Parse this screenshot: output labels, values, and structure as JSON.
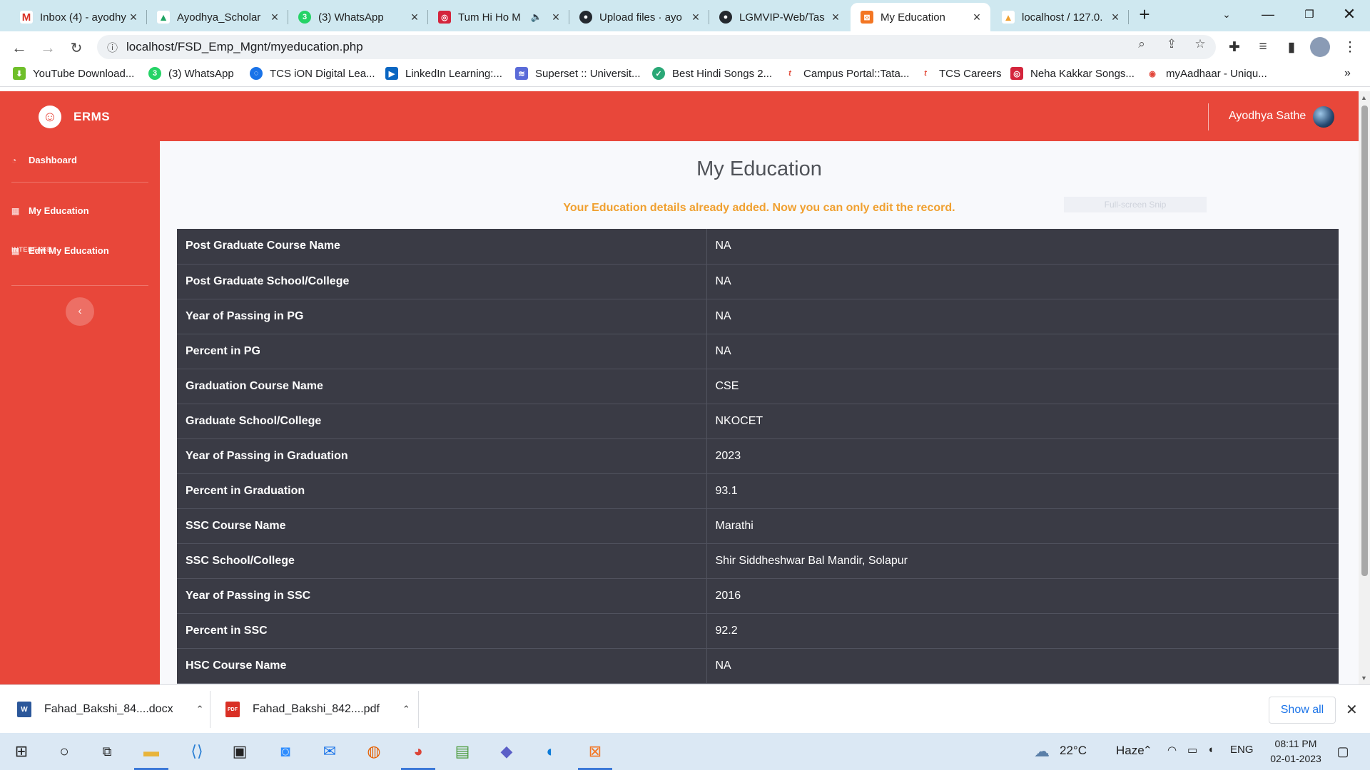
{
  "browser": {
    "tabs": [
      {
        "title": "Inbox (4) - ayodhy",
        "icon": "gmail-icon",
        "color": "#d93025",
        "glyph": "M"
      },
      {
        "title": "Ayodhya_Scholar",
        "icon": "google-drive-icon",
        "color": "#1fa463",
        "glyph": "▲"
      },
      {
        "title": "(3) WhatsApp",
        "icon": "whatsapp-icon",
        "color": "#25d366",
        "glyph": "3"
      },
      {
        "title": "Tum Hi Ho M",
        "icon": "music-app-icon",
        "color": "#d4253c",
        "glyph": "◎"
      },
      {
        "title": "Upload files · ayo",
        "icon": "github-icon",
        "color": "#24292f",
        "glyph": "●"
      },
      {
        "title": "LGMVIP-Web/Tas",
        "icon": "github-icon",
        "color": "#24292f",
        "glyph": "●"
      },
      {
        "title": "My Education",
        "icon": "xampp-icon",
        "color": "#f37623",
        "glyph": "⊠"
      },
      {
        "title": "localhost / 127.0.",
        "icon": "phpmyadmin-icon",
        "color": "#f0a030",
        "glyph": "▴"
      }
    ],
    "url": "localhost/FSD_Emp_Mgnt/myeducation.php",
    "bookmarks": [
      {
        "label": "YouTube Download...",
        "icon": "download-icon",
        "color": "#6fbf2a",
        "glyph": "⬇"
      },
      {
        "label": "(3) WhatsApp",
        "icon": "whatsapp-icon",
        "color": "#25d366",
        "glyph": "3"
      },
      {
        "label": "TCS iON Digital Lea...",
        "icon": "tcs-ion-icon",
        "color": "#1a73e8",
        "glyph": "◌"
      },
      {
        "label": "LinkedIn Learning:...",
        "icon": "linkedin-icon",
        "color": "#0a66c2",
        "glyph": "▶"
      },
      {
        "label": "Superset :: Universit...",
        "icon": "superset-icon",
        "color": "#5a6bd8",
        "glyph": "≋"
      },
      {
        "label": "Best Hindi Songs 2...",
        "icon": "songs-icon",
        "color": "#2aa876",
        "glyph": "✓"
      },
      {
        "label": "Campus Portal::Tata...",
        "icon": "tcs-icon",
        "color": "#e24b3a",
        "glyph": "t"
      },
      {
        "label": "TCS Careers",
        "icon": "tcs-icon",
        "color": "#e24b3a",
        "glyph": "t"
      },
      {
        "label": "Neha Kakkar Songs...",
        "icon": "music-app-icon",
        "color": "#d4253c",
        "glyph": "◎"
      },
      {
        "label": "myAadhaar - Uniqu...",
        "icon": "aadhaar-icon",
        "color": "#e2463a",
        "glyph": "◉"
      }
    ]
  },
  "app": {
    "brand": "ERMS",
    "user_name": "Ayodhya Sathe",
    "sidebar": {
      "dashboard": "Dashboard",
      "heading": "INTERFACE",
      "my_education": "My Education",
      "edit_my_education": "Edit My Education",
      "toggle_glyph": "‹"
    },
    "page_title": "My Education",
    "notice": "Your Education details already added. Now you can only edit the record.",
    "snip_hint": "Full-screen Snip",
    "rows": [
      {
        "label": "Post Graduate Course Name",
        "value": "NA"
      },
      {
        "label": "Post Graduate School/College",
        "value": "NA"
      },
      {
        "label": "Year of Passing in PG",
        "value": "NA"
      },
      {
        "label": "Percent in PG",
        "value": "NA"
      },
      {
        "label": "Graduation Course Name",
        "value": "CSE"
      },
      {
        "label": "Graduate School/College",
        "value": "NKOCET"
      },
      {
        "label": "Year of Passing in Graduation",
        "value": "2023"
      },
      {
        "label": "Percent in Graduation",
        "value": "93.1"
      },
      {
        "label": "SSC Course Name",
        "value": "Marathi"
      },
      {
        "label": "SSC School/College",
        "value": "Shir Siddheshwar Bal Mandir, Solapur"
      },
      {
        "label": "Year of Passing in SSC",
        "value": "2016"
      },
      {
        "label": "Percent in SSC",
        "value": "92.2"
      },
      {
        "label": "HSC Course Name",
        "value": "NA"
      }
    ],
    "colors": {
      "primary": "#e8473a",
      "table_bg": "#3a3b45",
      "notice": "#f0a030"
    }
  },
  "downloads": {
    "items": [
      {
        "name": "Fahad_Bakshi_84....docx",
        "icon": "word-doc-icon",
        "color": "#2b579a",
        "glyph": "W"
      },
      {
        "name": "Fahad_Bakshi_842....pdf",
        "icon": "pdf-icon",
        "color": "#d93025",
        "glyph": "PDF"
      }
    ],
    "show_all": "Show all"
  },
  "taskbar": {
    "weather_temp": "22°C",
    "weather_cond": "Haze",
    "lang": "ENG",
    "time": "08:11 PM",
    "date": "02-01-2023"
  }
}
